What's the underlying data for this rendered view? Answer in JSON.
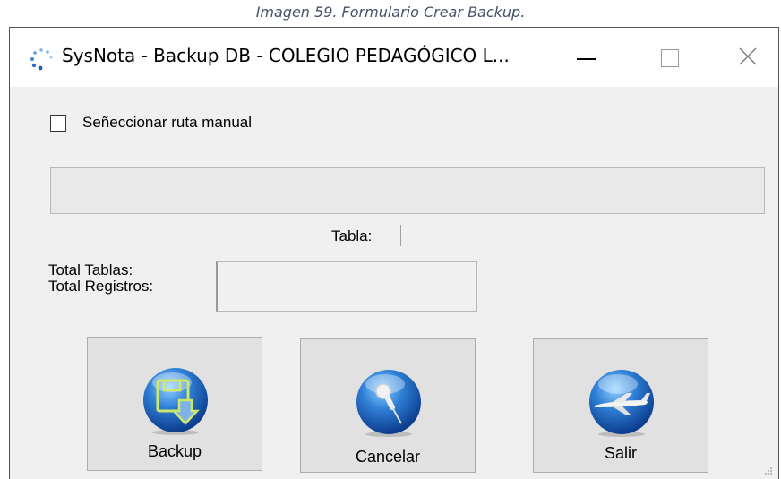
{
  "caption": "Imagen 59. Formulario Crear Backup.",
  "window": {
    "title": "SysNota - Backup DB - COLEGIO PEDAGÓGICO L...",
    "app_icon": "spinner-dots-icon",
    "controls": {
      "minimize": "minimize-icon",
      "maximize": "maximize-icon",
      "close": "close-icon"
    }
  },
  "form": {
    "manual_path_checkbox": {
      "label": "Señeccionar ruta manual",
      "checked": false
    },
    "path_value": "",
    "tabla_label": "Tabla:",
    "tabla_value": "",
    "total_tablas_label": "Total Tablas:",
    "total_registros_label": "Total Registros:"
  },
  "buttons": {
    "backup": {
      "label": "Backup",
      "icon": "floppy-download-icon"
    },
    "cancelar": {
      "label": "Cancelar",
      "icon": "pushpin-icon"
    },
    "salir": {
      "label": "Salir",
      "icon": "airplane-icon"
    }
  },
  "colors": {
    "orb_blue": "#1a56b0",
    "orb_light": "#5fb0f0",
    "window_bg": "#f0f0f0",
    "caption": "#44546a"
  }
}
